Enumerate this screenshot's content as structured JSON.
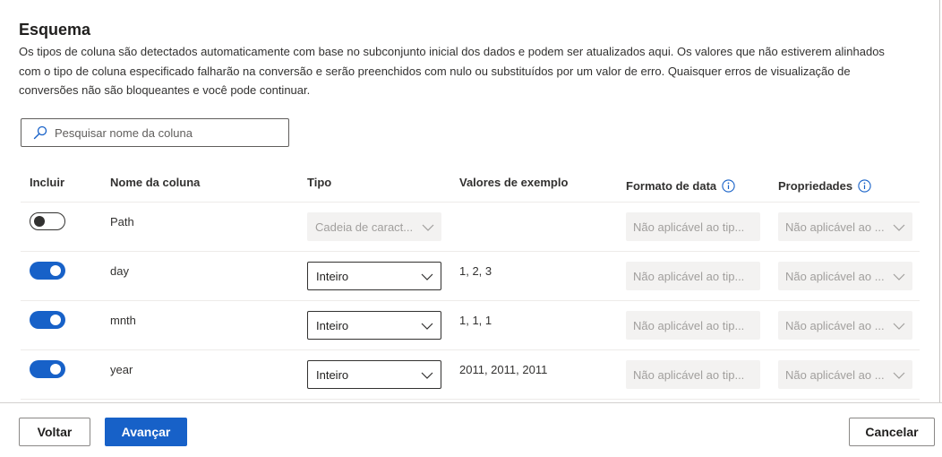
{
  "header": {
    "title": "Esquema",
    "description": "Os tipos de coluna são detectados automaticamente com base no subconjunto inicial dos dados e podem ser atualizados aqui. Os valores que não estiverem alinhados com o tipo de coluna especificado falharão na conversão e serão preenchidos com nulo ou substituídos por um valor de erro. Quaisquer erros de visualização de conversões não são bloqueantes e você pode continuar."
  },
  "search": {
    "placeholder": "Pesquisar nome da coluna",
    "icon": "search-icon"
  },
  "table": {
    "headers": {
      "include": "Incluir",
      "column_name": "Nome da coluna",
      "type": "Tipo",
      "sample_values": "Valores de exemplo",
      "date_format": "Formato de data",
      "properties": "Propriedades"
    },
    "rows": [
      {
        "include": false,
        "name": "Path",
        "type": "Cadeia de caract...",
        "type_enabled": false,
        "sample": "",
        "date_format": "Não aplicável ao tip...",
        "properties": "Não aplicável ao ..."
      },
      {
        "include": true,
        "name": "day",
        "type": "Inteiro",
        "type_enabled": true,
        "sample": "1, 2, 3",
        "date_format": "Não aplicável ao tip...",
        "properties": "Não aplicável ao ..."
      },
      {
        "include": true,
        "name": "mnth",
        "type": "Inteiro",
        "type_enabled": true,
        "sample": "1, 1, 1",
        "date_format": "Não aplicável ao tip...",
        "properties": "Não aplicável ao ..."
      },
      {
        "include": true,
        "name": "year",
        "type": "Inteiro",
        "type_enabled": true,
        "sample": "2011, 2011, 2011",
        "date_format": "Não aplicável ao tip...",
        "properties": "Não aplicável ao ..."
      }
    ]
  },
  "footer": {
    "back_label": "Voltar",
    "next_label": "Avançar",
    "cancel_label": "Cancelar"
  },
  "colors": {
    "accent": "#1761c8",
    "disabled_bg": "#f3f2f1",
    "disabled_text": "#a19f9d"
  }
}
